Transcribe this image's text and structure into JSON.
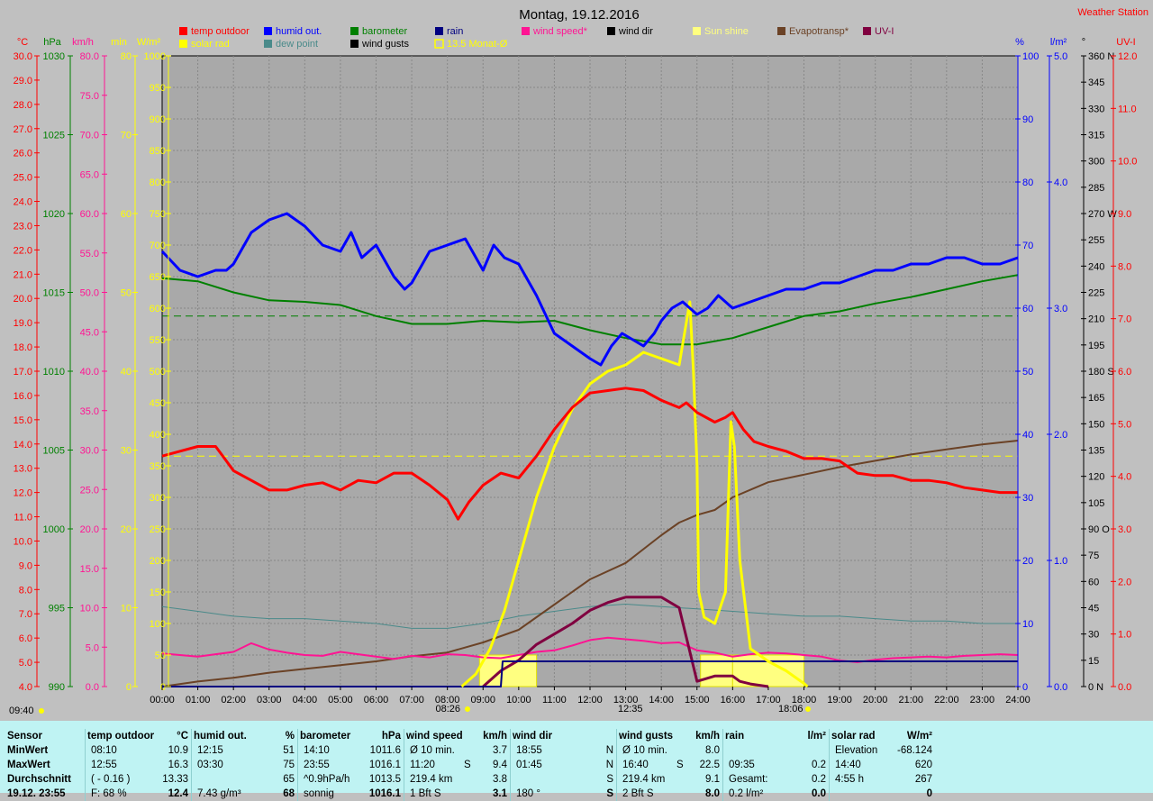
{
  "window": {
    "title": "Montag, 19.12.2016",
    "brand": "Weather Station",
    "corner_label": "09:40"
  },
  "legend": [
    {
      "label": "temp outdoor",
      "color": "#ff0000"
    },
    {
      "label": "humid out.",
      "color": "#0000ff"
    },
    {
      "label": "barometer",
      "color": "#008000"
    },
    {
      "label": "rain",
      "color": "#000080"
    },
    {
      "label": "wind speed*",
      "color": "#ff1493"
    },
    {
      "label": "wind dir",
      "color": "#000000"
    },
    {
      "label": "Sun shine",
      "color": "#ffff80"
    },
    {
      "label": "Evapotransp*",
      "color": "#6b4226"
    },
    {
      "label": "UV-I",
      "color": "#800040"
    },
    {
      "label": "solar rad",
      "color": "#ffff00"
    },
    {
      "label": "dew point",
      "color": "#4a8a8a"
    },
    {
      "label": "wind gusts",
      "color": "#000000"
    },
    {
      "label": "13.5 Monat-Ø",
      "color": "#ffff00"
    }
  ],
  "axes": {
    "temp": {
      "unit": "°C",
      "ticks": [
        "30.0",
        "29.0",
        "28.0",
        "27.0",
        "26.0",
        "25.0",
        "24.0",
        "23.0",
        "22.0",
        "21.0",
        "20.0",
        "19.0",
        "18.0",
        "17.0",
        "16.0",
        "15.0",
        "14.0",
        "13.0",
        "12.0",
        "11.0",
        "10.0",
        "9.0",
        "8.0",
        "7.0",
        "6.0",
        "5.0",
        "4.0"
      ]
    },
    "pressure": {
      "unit": "hPa",
      "ticks": [
        "1030",
        "1025",
        "1020",
        "1015",
        "1010",
        "1005",
        "1000",
        "995",
        "990"
      ]
    },
    "wind": {
      "unit": "km/h",
      "ticks": [
        "80.0",
        "75.0",
        "70.0",
        "65.0",
        "60.0",
        "55.0",
        "50.0",
        "45.0",
        "40.0",
        "35.0",
        "30.0",
        "25.0",
        "20.0",
        "15.0",
        "10.0",
        "5.0",
        "0.0"
      ]
    },
    "minutes": {
      "unit": "min",
      "ticks": [
        "80",
        "70",
        "60",
        "50",
        "40",
        "30",
        "20",
        "10",
        "0"
      ]
    },
    "solar": {
      "unit": "W/m²",
      "ticks": [
        "1000",
        "950",
        "900",
        "850",
        "800",
        "750",
        "700",
        "650",
        "600",
        "550",
        "500",
        "450",
        "400",
        "350",
        "300",
        "250",
        "200",
        "150",
        "100",
        "50",
        "0"
      ]
    },
    "humidity": {
      "unit": "%",
      "ticks": [
        "100",
        "90",
        "80",
        "70",
        "60",
        "50",
        "40",
        "30",
        "20",
        "10",
        "0"
      ]
    },
    "rain": {
      "unit": "l/m²",
      "ticks": [
        "5.0",
        "4.0",
        "3.0",
        "2.0",
        "1.0",
        "0.0"
      ]
    },
    "direction": {
      "unit": "°",
      "ticks": [
        "360 N",
        "345",
        "330",
        "315",
        "300",
        "285",
        "270 W",
        "255",
        "240",
        "225",
        "210",
        "195",
        "180 S",
        "165",
        "150",
        "135",
        "120",
        "105",
        "90 O",
        "75",
        "60",
        "45",
        "30",
        "15",
        "0 N"
      ]
    },
    "uv": {
      "unit": "UV-I",
      "ticks": [
        "12.0",
        "11.0",
        "10.0",
        "9.0",
        "8.0",
        "7.0",
        "6.0",
        "5.0",
        "4.0",
        "3.0",
        "2.0",
        "1.0",
        "0.0"
      ]
    },
    "time": {
      "ticks": [
        "00:00",
        "01:00",
        "02:00",
        "03:00",
        "04:00",
        "05:00",
        "06:00",
        "07:00",
        "08:00",
        "09:00",
        "10:00",
        "11:00",
        "12:00",
        "13:00",
        "14:00",
        "15:00",
        "16:00",
        "17:00",
        "18:00",
        "19:00",
        "20:00",
        "21:00",
        "22:00",
        "23:00",
        "24:00"
      ]
    }
  },
  "markers": {
    "sunrise": "08:26",
    "noon": "12:35",
    "sunset": "18:06"
  },
  "chart_data": {
    "type": "line",
    "title": "Montag, 19.12.2016",
    "xlabel": "",
    "x_unit": "hours",
    "xlim": [
      0,
      24
    ],
    "series": [
      {
        "name": "temp outdoor",
        "axis": "°C",
        "ylim": [
          4,
          30
        ],
        "color": "#ff0000",
        "x": [
          0,
          0.5,
          1,
          1.5,
          1.8,
          2,
          2.5,
          3,
          3.5,
          4,
          4.5,
          5,
          5.5,
          6,
          6.5,
          7,
          7.5,
          8,
          8.3,
          8.6,
          9,
          9.5,
          10,
          10.5,
          11,
          11.5,
          12,
          12.5,
          13,
          13.5,
          14,
          14.5,
          14.7,
          15,
          15.5,
          15.8,
          16,
          16.3,
          16.6,
          17,
          17.5,
          18,
          18.5,
          19,
          19.5,
          20,
          20.5,
          21,
          21.5,
          22,
          22.5,
          23,
          23.5,
          24
        ],
        "values": [
          13.5,
          13.7,
          13.9,
          13.9,
          13.3,
          12.9,
          12.5,
          12.1,
          12.1,
          12.3,
          12.4,
          12.1,
          12.5,
          12.4,
          12.8,
          12.8,
          12.3,
          11.7,
          10.9,
          11.6,
          12.3,
          12.8,
          12.6,
          13.5,
          14.6,
          15.5,
          16.1,
          16.2,
          16.3,
          16.2,
          15.8,
          15.5,
          15.7,
          15.3,
          14.9,
          15.1,
          15.3,
          14.6,
          14.1,
          13.9,
          13.7,
          13.4,
          13.4,
          13.3,
          12.8,
          12.7,
          12.7,
          12.5,
          12.5,
          12.4,
          12.2,
          12.1,
          12.0,
          12.0
        ]
      },
      {
        "name": "humid out.",
        "axis": "%",
        "ylim": [
          0,
          100
        ],
        "color": "#0000ff",
        "x": [
          0,
          0.5,
          1,
          1.5,
          1.8,
          2,
          2.5,
          3,
          3.5,
          4,
          4.5,
          5,
          5.3,
          5.6,
          6,
          6.5,
          6.8,
          7,
          7.5,
          8,
          8.5,
          9,
          9.3,
          9.6,
          10,
          10.5,
          11,
          11.5,
          12,
          12.3,
          12.6,
          12.9,
          13.2,
          13.5,
          13.8,
          14,
          14.3,
          14.6,
          15,
          15.3,
          15.6,
          16,
          16.5,
          17,
          17.5,
          18,
          18.5,
          19,
          19.5,
          20,
          20.5,
          21,
          21.5,
          22,
          22.5,
          23,
          23.5,
          24
        ],
        "values": [
          69,
          66,
          65,
          66,
          66,
          67,
          72,
          74,
          75,
          73,
          70,
          69,
          72,
          68,
          70,
          65,
          63,
          64,
          69,
          70,
          71,
          66,
          70,
          68,
          67,
          62,
          56,
          54,
          52,
          51,
          54,
          56,
          55,
          54,
          56,
          58,
          60,
          61,
          59,
          60,
          62,
          60,
          61,
          62,
          63,
          63,
          64,
          64,
          65,
          66,
          66,
          67,
          67,
          68,
          68,
          67,
          67,
          68
        ]
      },
      {
        "name": "dew point",
        "axis": "°C",
        "ylim": [
          4,
          30
        ],
        "color": "#4a8a8a",
        "x": [
          0,
          1,
          2,
          3,
          4,
          5,
          6,
          7,
          8,
          9,
          10,
          11,
          12,
          13,
          14,
          15,
          16,
          17,
          18,
          19,
          20,
          21,
          22,
          23,
          24
        ],
        "values": [
          7.3,
          7.1,
          6.9,
          6.8,
          6.8,
          6.7,
          6.6,
          6.4,
          6.4,
          6.6,
          6.9,
          7.1,
          7.3,
          7.4,
          7.3,
          7.2,
          7.1,
          7.0,
          6.9,
          6.9,
          6.8,
          6.7,
          6.7,
          6.6,
          6.6
        ]
      },
      {
        "name": "barometer",
        "axis": "hPa",
        "ylim": [
          990,
          1030
        ],
        "color": "#008000",
        "x": [
          0,
          1,
          2,
          3,
          4,
          5,
          6,
          7,
          8,
          9,
          10,
          11,
          12,
          13,
          14,
          15,
          16,
          17,
          18,
          19,
          20,
          21,
          22,
          23,
          24
        ],
        "values": [
          1015.9,
          1015.7,
          1015.0,
          1014.5,
          1014.4,
          1014.2,
          1013.5,
          1013.0,
          1013.0,
          1013.2,
          1013.1,
          1013.2,
          1012.6,
          1012.1,
          1011.7,
          1011.7,
          1012.1,
          1012.8,
          1013.5,
          1013.8,
          1014.3,
          1014.7,
          1015.2,
          1015.7,
          1016.1
        ]
      },
      {
        "name": "solar rad",
        "axis": "W/m²",
        "ylim": [
          0,
          1000
        ],
        "color": "#ffff00",
        "x": [
          8.4,
          8.8,
          9.2,
          9.6,
          10,
          10.5,
          11,
          11.5,
          12,
          12.5,
          13,
          13.5,
          14,
          14.5,
          14.8,
          14.9,
          15.0,
          15.05,
          15.2,
          15.5,
          15.8,
          15.95,
          16.05,
          16.2,
          16.5,
          17,
          17.5,
          18,
          18.1
        ],
        "values": [
          0,
          20,
          60,
          120,
          200,
          300,
          380,
          440,
          480,
          500,
          510,
          530,
          520,
          510,
          610,
          500,
          350,
          150,
          110,
          100,
          150,
          420,
          380,
          200,
          60,
          40,
          25,
          5,
          0
        ]
      },
      {
        "name": "wind speed*",
        "axis": "km/h",
        "ylim": [
          0,
          80
        ],
        "color": "#ff1493",
        "x": [
          0,
          1,
          2,
          2.5,
          3,
          3.5,
          4,
          4.5,
          5,
          5.5,
          6,
          6.5,
          7,
          7.5,
          8,
          8.5,
          9,
          9.5,
          10,
          10.5,
          11,
          11.5,
          12,
          12.5,
          13,
          13.5,
          14,
          14.5,
          15,
          15.5,
          16,
          16.5,
          17,
          17.5,
          18,
          18.5,
          19,
          19.5,
          20,
          20.5,
          21,
          21.5,
          22,
          22.5,
          23,
          23.5,
          24
        ],
        "values": [
          4.2,
          3.8,
          4.4,
          5.5,
          4.7,
          4.3,
          4.0,
          3.9,
          4.4,
          4.1,
          3.8,
          3.5,
          3.9,
          3.7,
          4.1,
          4.0,
          3.7,
          3.6,
          4.0,
          4.4,
          4.6,
          5.2,
          5.9,
          6.2,
          6.0,
          5.8,
          5.5,
          5.6,
          4.6,
          4.3,
          3.8,
          4.1,
          4.3,
          4.2,
          4.0,
          3.8,
          3.3,
          3.1,
          3.4,
          3.6,
          3.7,
          3.8,
          3.7,
          3.9,
          4.0,
          4.1,
          4.0
        ]
      },
      {
        "name": "Evapotransp*",
        "axis": "l/m²",
        "ylim": [
          0,
          5
        ],
        "color": "#6b4226",
        "x": [
          0,
          1,
          2,
          3,
          4,
          5,
          6,
          7,
          8,
          9,
          10,
          11,
          12,
          13,
          14,
          14.5,
          15,
          15.5,
          16,
          16.5,
          17,
          18,
          19,
          20,
          21,
          22,
          23,
          24
        ],
        "values": [
          0,
          0.04,
          0.07,
          0.11,
          0.14,
          0.17,
          0.2,
          0.24,
          0.27,
          0.35,
          0.45,
          0.65,
          0.85,
          0.98,
          1.2,
          1.3,
          1.36,
          1.4,
          1.5,
          1.56,
          1.62,
          1.68,
          1.74,
          1.79,
          1.84,
          1.88,
          1.92,
          1.95
        ]
      },
      {
        "name": "UV-I",
        "axis": "UV-I",
        "ylim": [
          0,
          12
        ],
        "color": "#800040",
        "x": [
          9.0,
          9.5,
          10,
          10.5,
          11,
          11.5,
          12,
          12.5,
          13,
          13.5,
          14,
          14.5,
          15,
          15.5,
          16,
          16.2,
          16.5,
          17
        ],
        "values": [
          0,
          0.3,
          0.5,
          0.8,
          1.0,
          1.2,
          1.45,
          1.6,
          1.7,
          1.7,
          1.7,
          1.5,
          0.1,
          0.2,
          0.2,
          0.1,
          0.05,
          0
        ]
      },
      {
        "name": "rain",
        "axis": "l/m²",
        "ylim": [
          0,
          5
        ],
        "color": "#000080",
        "x": [
          0,
          9.5,
          9.55,
          24
        ],
        "values": [
          0,
          0,
          0.2,
          0.2
        ]
      }
    ],
    "reference_lines": [
      {
        "name": "13.5 Monat-Ø",
        "value": 13.5,
        "axis": "°C",
        "color": "#ffff00"
      },
      {
        "name": "barometer avg",
        "value": 1013.5,
        "axis": "hPa",
        "color": "#008000"
      }
    ],
    "sunshine_periods": [
      [
        8.9,
        10.5
      ],
      [
        15.1,
        16.0
      ],
      [
        16.0,
        18.0
      ]
    ],
    "grid": true,
    "legend_position": "top"
  },
  "stats": {
    "header": {
      "sensor": "Sensor",
      "min": "MinWert",
      "max": "MaxWert",
      "avg": "Durchschnitt",
      "now": "19.12. 23:55"
    },
    "groups": [
      {
        "title": "temp outdoor",
        "unit": "°C",
        "rows": [
          [
            "08:10",
            "",
            "10.9"
          ],
          [
            "12:55",
            "",
            "16.3"
          ],
          [
            "( - 0.16 )",
            "",
            "13.33"
          ],
          [
            "F: 68 %",
            "",
            "12.4"
          ]
        ]
      },
      {
        "title": "humid out.",
        "unit": "%",
        "rows": [
          [
            "12:15",
            "",
            "51"
          ],
          [
            "03:30",
            "",
            "75"
          ],
          [
            "",
            "",
            "65"
          ],
          [
            "7.43 g/m³",
            "",
            "68"
          ]
        ]
      },
      {
        "title": "barometer",
        "unit": "hPa",
        "rows": [
          [
            "14:10",
            "",
            "1011.6"
          ],
          [
            "23:55",
            "",
            "1016.1"
          ],
          [
            "^0.9hPa/h",
            "",
            "1013.5"
          ],
          [
            "sonnig",
            "",
            "1016.1"
          ]
        ]
      },
      {
        "title": "wind speed",
        "unit": "km/h",
        "rows": [
          [
            "Ø 10 min.",
            "",
            "3.7"
          ],
          [
            "11:20",
            "S",
            "9.4"
          ],
          [
            "219.4 km",
            "",
            "3.8"
          ],
          [
            "1 Bft S",
            "",
            "3.1"
          ]
        ]
      },
      {
        "title": "wind dir",
        "unit": "",
        "rows": [
          [
            "18:55",
            "",
            "N"
          ],
          [
            "01:45",
            "",
            "N"
          ],
          [
            "",
            "",
            "S"
          ],
          [
            "180 °",
            "",
            "S"
          ]
        ]
      },
      {
        "title": "wind gusts",
        "unit": "km/h",
        "rows": [
          [
            "Ø 10 min.",
            "",
            "8.0"
          ],
          [
            "16:40",
            "S",
            "22.5"
          ],
          [
            "219.4 km",
            "",
            "9.1"
          ],
          [
            "2 Bft S",
            "",
            "8.0"
          ]
        ]
      },
      {
        "title": "rain",
        "unit": "l/m²",
        "rows": [
          [
            "",
            "",
            ""
          ],
          [
            "09:35",
            "",
            "0.2"
          ],
          [
            "Gesamt:",
            "",
            "0.2"
          ],
          [
            "0.2 l/m²",
            "",
            "0.0"
          ]
        ]
      },
      {
        "title": "solar rad",
        "unit": "W/m²",
        "rows": [
          [
            "Elevation",
            "",
            "-68.124"
          ],
          [
            "14:40",
            "",
            "620"
          ],
          [
            "4:55 h",
            "",
            "267"
          ],
          [
            "",
            "",
            "0"
          ]
        ]
      }
    ]
  }
}
